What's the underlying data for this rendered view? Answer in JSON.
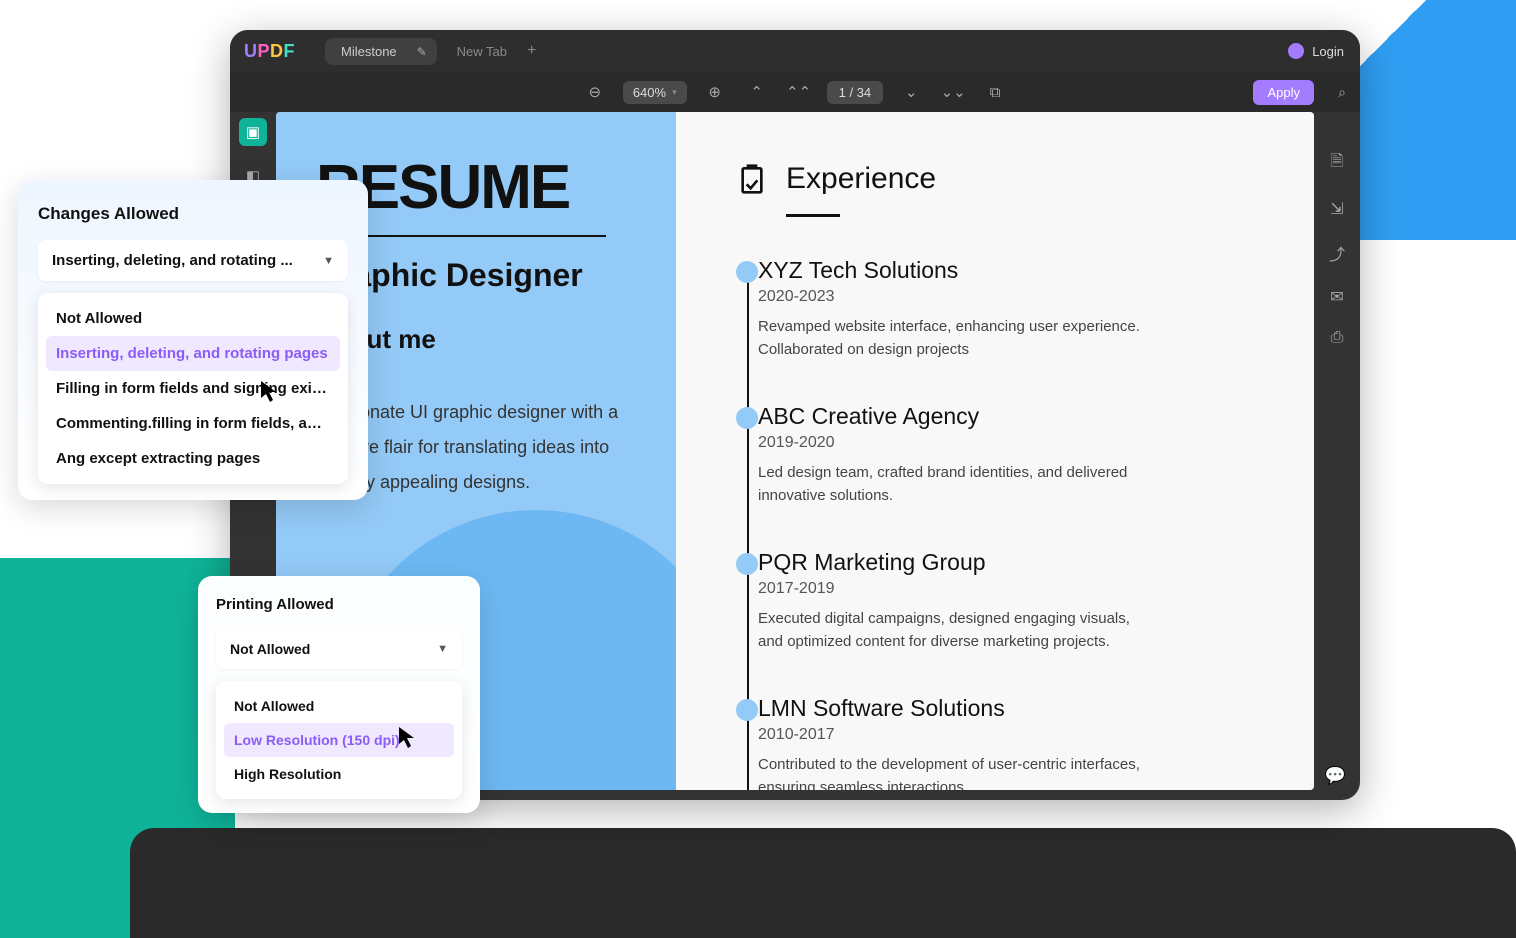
{
  "brand": "UPDF",
  "tabs": {
    "active": "Milestone",
    "new": "New Tab"
  },
  "login": "Login",
  "toolbar": {
    "zoom": "640%",
    "page_current": "1",
    "page_total": "34",
    "apply": "Apply"
  },
  "resume": {
    "title": "RESUME",
    "role": "Graphic Designer",
    "about_h": "About me",
    "about_p": "Passionate UI graphic designer with a creative flair for translating ideas into visually appealing designs.",
    "exp_h": "Experience",
    "items": [
      {
        "title": "XYZ Tech Solutions",
        "dates": "2020-2023",
        "desc": "Revamped website interface, enhancing user experience. Collaborated on design projects"
      },
      {
        "title": "ABC Creative Agency",
        "dates": "2019-2020",
        "desc": "Led design team, crafted brand identities, and delivered innovative solutions."
      },
      {
        "title": "PQR Marketing Group",
        "dates": "2017-2019",
        "desc": "Executed digital campaigns, designed engaging visuals, and optimized content for diverse marketing projects."
      },
      {
        "title": "LMN Software Solutions",
        "dates": "2010-2017",
        "desc": "Contributed to the development of user-centric interfaces, ensuring seamless interactions."
      }
    ]
  },
  "changes_popup": {
    "title": "Changes Allowed",
    "selected": "Inserting, deleting, and rotating ...",
    "options": [
      "Not Allowed",
      "Inserting, deleting, and rotating pages",
      "Filling in form fields and signing existi...",
      "Commenting.filling in form fields, and...",
      "Ang except extracting pages"
    ],
    "selected_index": 1
  },
  "printing_popup": {
    "title": "Printing Allowed",
    "selected": "Not Allowed",
    "options": [
      "Not Allowed",
      "Low Resolution (150 dpi)",
      "High Resolution"
    ],
    "selected_index": 1
  }
}
